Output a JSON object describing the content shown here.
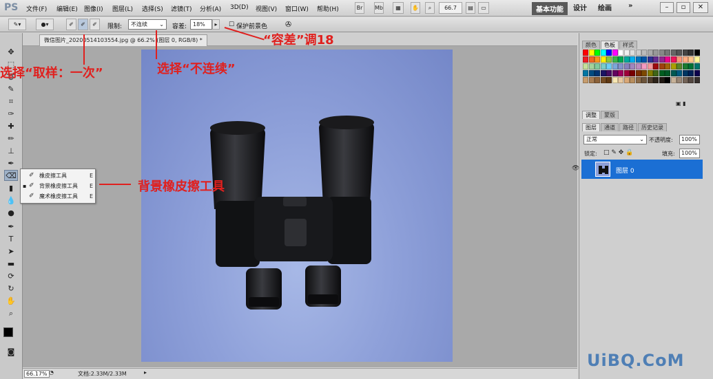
{
  "app": {
    "logo": "PS"
  },
  "menu": [
    "文件(F)",
    "编辑(E)",
    "图像(I)",
    "图层(L)",
    "选择(S)",
    "滤镜(T)",
    "分析(A)",
    "3D(D)",
    "视图(V)",
    "窗口(W)",
    "帮助(H)"
  ],
  "toolbar_top": {
    "zoom": "66.7",
    "workspaces": [
      "基本功能",
      "设计",
      "绘画"
    ]
  },
  "options": {
    "limit_label": "限制:",
    "limit_value": "不连续",
    "tolerance_label": "容差:",
    "tolerance_value": "18%",
    "protect_label": "保护前景色"
  },
  "document": {
    "tab_title": "微信图片_20200514103554.jpg @ 66.2% (图层 0, RGB/8) *"
  },
  "status": {
    "zoom": "66.17%",
    "doc": "文档:2.33M/2.33M"
  },
  "flyout": [
    {
      "label": "橡皮擦工具",
      "key": "E"
    },
    {
      "label": "背景橡皮擦工具",
      "key": "E"
    },
    {
      "label": "魔术橡皮擦工具",
      "key": "E"
    }
  ],
  "panels": {
    "swatch_tabs": [
      "颜色",
      "色板",
      "样式"
    ],
    "adjust_tabs": [
      "调整",
      "蒙版"
    ],
    "layer_tabs": [
      "图层",
      "通道",
      "路径",
      "历史记录"
    ],
    "blend_mode": "正常",
    "opacity_label": "不透明度:",
    "opacity_value": "100%",
    "lock_label": "锁定:",
    "fill_label": "填充:",
    "fill_value": "100%",
    "layer_name": "图层 0"
  },
  "annotations": {
    "sample": "选择“取样：一次”",
    "contiguous": "选择“不连续”",
    "tolerance": "“容差”调18",
    "tool": "背景橡皮擦工具"
  },
  "watermark": "UiBQ.CoM",
  "colors": {
    "annotation": "#e0201e",
    "selection": "#1b6fd4",
    "canvas_bg": "#8ea0d9"
  }
}
